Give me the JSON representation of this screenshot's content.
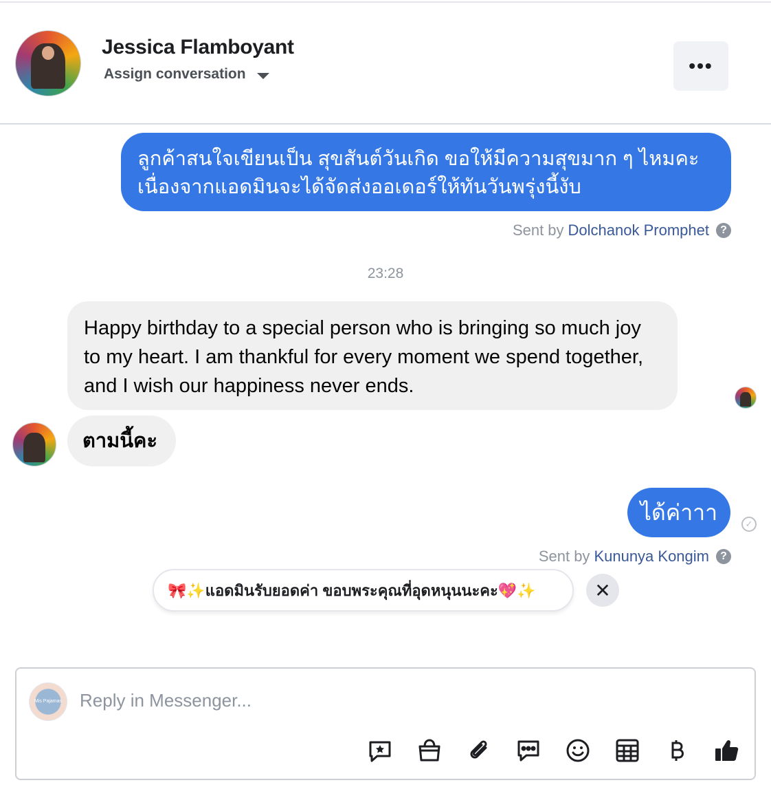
{
  "header": {
    "contact_name": "Jessica Flamboyant",
    "assign_label": "Assign conversation",
    "more_label": "•••"
  },
  "messages": {
    "m1": {
      "direction": "outgoing",
      "text": "ลูกค้าสนใจเขียนเป็น สุขสันต์วันเกิด ขอให้มีความสุขมาก ๆ ไหมคะ เนื่องจากแอดมินจะได้จัดส่งออเดอร์ให้ทันวันพรุ่งนี้งับ",
      "sent_by_prefix": "Sent by",
      "sent_by_name": "Dolchanok Promphet"
    },
    "timestamp": "23:28",
    "m2": {
      "direction": "incoming",
      "text": "Happy birthday to a special person who is bringing so much joy to my heart. I am thankful for every moment we spend together, and I wish our happiness never ends."
    },
    "m3": {
      "direction": "incoming",
      "text": "ตามนี้คะ"
    },
    "m4": {
      "direction": "outgoing",
      "text": "ได้ค่าาา",
      "sent_by_prefix": "Sent by",
      "sent_by_name": "Kununya Kongim"
    }
  },
  "saved_reply_chip": {
    "text": "🎀✨แอดมินรับยอดค่า ขอบพระคุณที่อุดหนุนนะคะ💖✨",
    "close_label": "✕"
  },
  "composer": {
    "placeholder": "Reply in Messenger...",
    "page_avatar_text": "Mis Pajamas",
    "tools": [
      "saved-reply-icon",
      "shop-bag-icon",
      "attachment-icon",
      "chat-dots-icon",
      "emoji-icon",
      "table-icon",
      "baht-icon",
      "thumbs-up-icon"
    ]
  },
  "colors": {
    "outgoing_bubble": "#3578e5",
    "incoming_bubble": "#f0f0f0",
    "sender_name": "#385898"
  }
}
